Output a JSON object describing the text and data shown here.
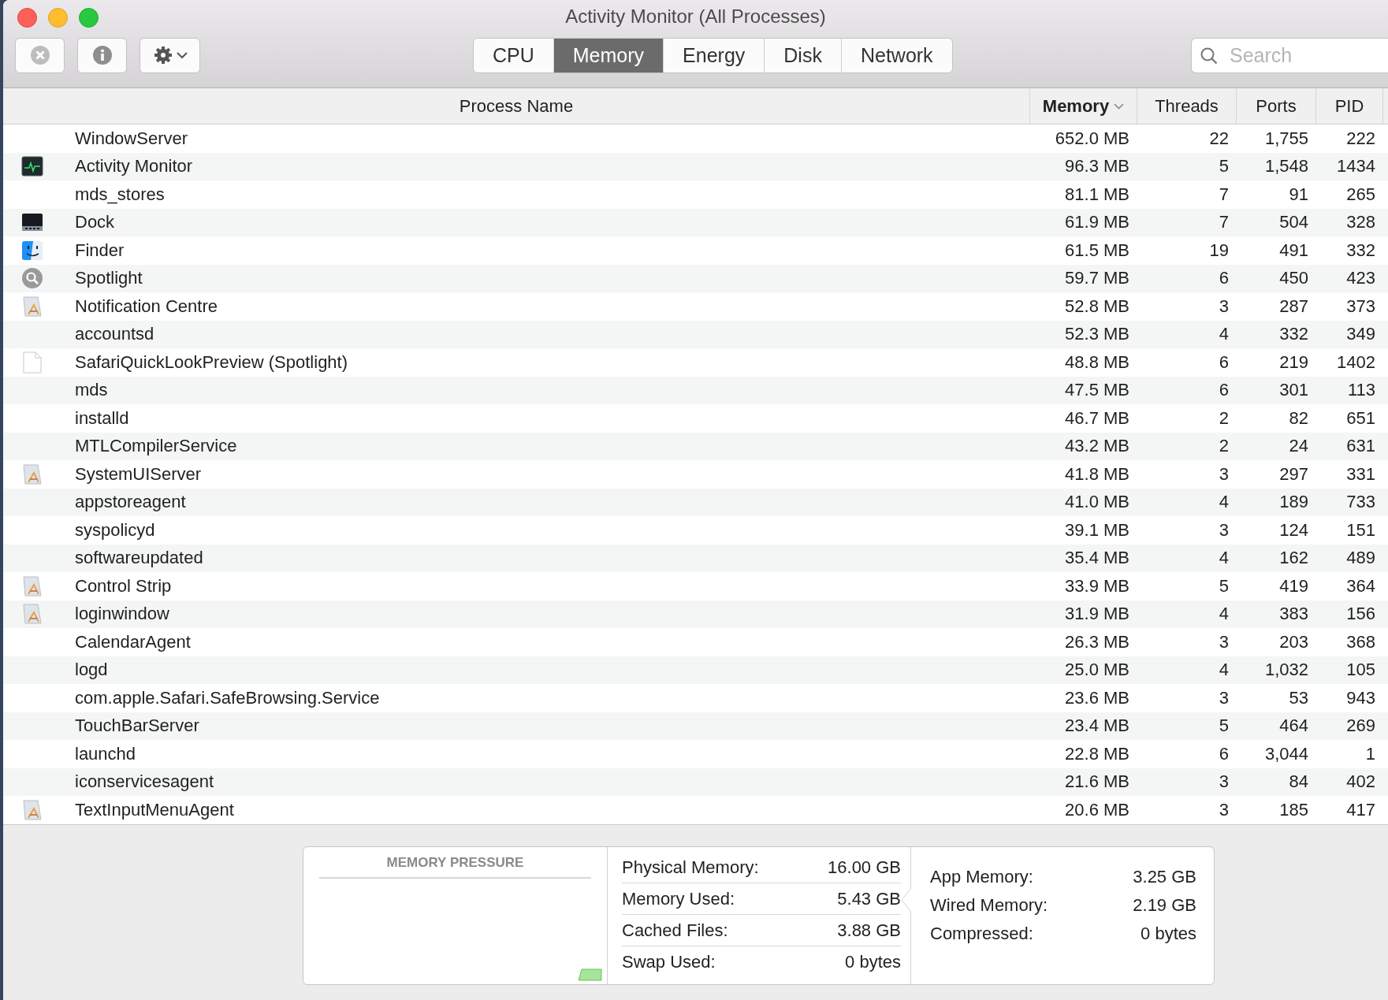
{
  "window": {
    "title": "Activity Monitor (All Processes)"
  },
  "toolbar": {
    "search": {
      "placeholder": "Search"
    }
  },
  "tabs": [
    {
      "label": "CPU",
      "selected": false
    },
    {
      "label": "Memory",
      "selected": true
    },
    {
      "label": "Energy",
      "selected": false
    },
    {
      "label": "Disk",
      "selected": false
    },
    {
      "label": "Network",
      "selected": false
    }
  ],
  "table": {
    "columns": [
      {
        "label": "Process Name",
        "sorted": false
      },
      {
        "label": "Memory",
        "sorted": true
      },
      {
        "label": "Threads",
        "sorted": false
      },
      {
        "label": "Ports",
        "sorted": false
      },
      {
        "label": "PID",
        "sorted": false
      }
    ],
    "rows": [
      {
        "kind": "plain",
        "cells": [
          "WindowServer",
          "652.0 MB",
          "22",
          "1,755",
          "222"
        ]
      },
      {
        "kind": "monitor",
        "cells": [
          "Activity Monitor",
          "96.3 MB",
          "5",
          "1,548",
          "1434"
        ]
      },
      {
        "kind": "plain",
        "cells": [
          "mds_stores",
          "81.1 MB",
          "7",
          "91",
          "265"
        ]
      },
      {
        "kind": "dock",
        "cells": [
          "Dock",
          "61.9 MB",
          "7",
          "504",
          "328"
        ]
      },
      {
        "kind": "finder",
        "cells": [
          "Finder",
          "61.5 MB",
          "19",
          "491",
          "332"
        ]
      },
      {
        "kind": "spotlight",
        "cells": [
          "Spotlight",
          "59.7 MB",
          "6",
          "450",
          "423"
        ]
      },
      {
        "kind": "app",
        "cells": [
          "Notification Centre",
          "52.8 MB",
          "3",
          "287",
          "373"
        ]
      },
      {
        "kind": "plain",
        "cells": [
          "accountsd",
          "52.3 MB",
          "4",
          "332",
          "349"
        ]
      },
      {
        "kind": "document",
        "cells": [
          "SafariQuickLookPreview (Spotlight)",
          "48.8 MB",
          "6",
          "219",
          "1402"
        ]
      },
      {
        "kind": "plain",
        "cells": [
          "mds",
          "47.5 MB",
          "6",
          "301",
          "113"
        ]
      },
      {
        "kind": "plain",
        "cells": [
          "installd",
          "46.7 MB",
          "2",
          "82",
          "651"
        ]
      },
      {
        "kind": "plain",
        "cells": [
          "MTLCompilerService",
          "43.2 MB",
          "2",
          "24",
          "631"
        ]
      },
      {
        "kind": "app",
        "cells": [
          "SystemUIServer",
          "41.8 MB",
          "3",
          "297",
          "331"
        ]
      },
      {
        "kind": "plain",
        "cells": [
          "appstoreagent",
          "41.0 MB",
          "4",
          "189",
          "733"
        ]
      },
      {
        "kind": "plain",
        "cells": [
          "syspolicyd",
          "39.1 MB",
          "3",
          "124",
          "151"
        ]
      },
      {
        "kind": "plain",
        "cells": [
          "softwareupdated",
          "35.4 MB",
          "4",
          "162",
          "489"
        ]
      },
      {
        "kind": "app",
        "cells": [
          "Control Strip",
          "33.9 MB",
          "5",
          "419",
          "364"
        ]
      },
      {
        "kind": "app",
        "cells": [
          "loginwindow",
          "31.9 MB",
          "4",
          "383",
          "156"
        ]
      },
      {
        "kind": "plain",
        "cells": [
          "CalendarAgent",
          "26.3 MB",
          "3",
          "203",
          "368"
        ]
      },
      {
        "kind": "plain",
        "cells": [
          "logd",
          "25.0 MB",
          "4",
          "1,032",
          "105"
        ]
      },
      {
        "kind": "plain",
        "cells": [
          "com.apple.Safari.SafeBrowsing.Service",
          "23.6 MB",
          "3",
          "53",
          "943"
        ]
      },
      {
        "kind": "plain",
        "cells": [
          "TouchBarServer",
          "23.4 MB",
          "5",
          "464",
          "269"
        ]
      },
      {
        "kind": "plain",
        "cells": [
          "launchd",
          "22.8 MB",
          "6",
          "3,044",
          "1"
        ]
      },
      {
        "kind": "plain",
        "cells": [
          "iconservicesagent",
          "21.6 MB",
          "3",
          "84",
          "402"
        ]
      },
      {
        "kind": "app",
        "cells": [
          "TextInputMenuAgent",
          "20.6 MB",
          "3",
          "185",
          "417"
        ]
      }
    ]
  },
  "memory_pressure": {
    "title": "MEMORY PRESSURE"
  },
  "memory_stats": [
    {
      "label": "Physical Memory:",
      "value": "16.00 GB"
    },
    {
      "label": "Memory Used:",
      "value": "5.43 GB"
    },
    {
      "label": "Cached Files:",
      "value": "3.88 GB"
    },
    {
      "label": "Swap Used:",
      "value": "0 bytes"
    }
  ],
  "memory_breakdown": [
    {
      "label": "App Memory:",
      "value": "3.25 GB"
    },
    {
      "label": "Wired Memory:",
      "value": "2.19 GB"
    },
    {
      "label": "Compressed:",
      "value": "0 bytes"
    }
  ]
}
